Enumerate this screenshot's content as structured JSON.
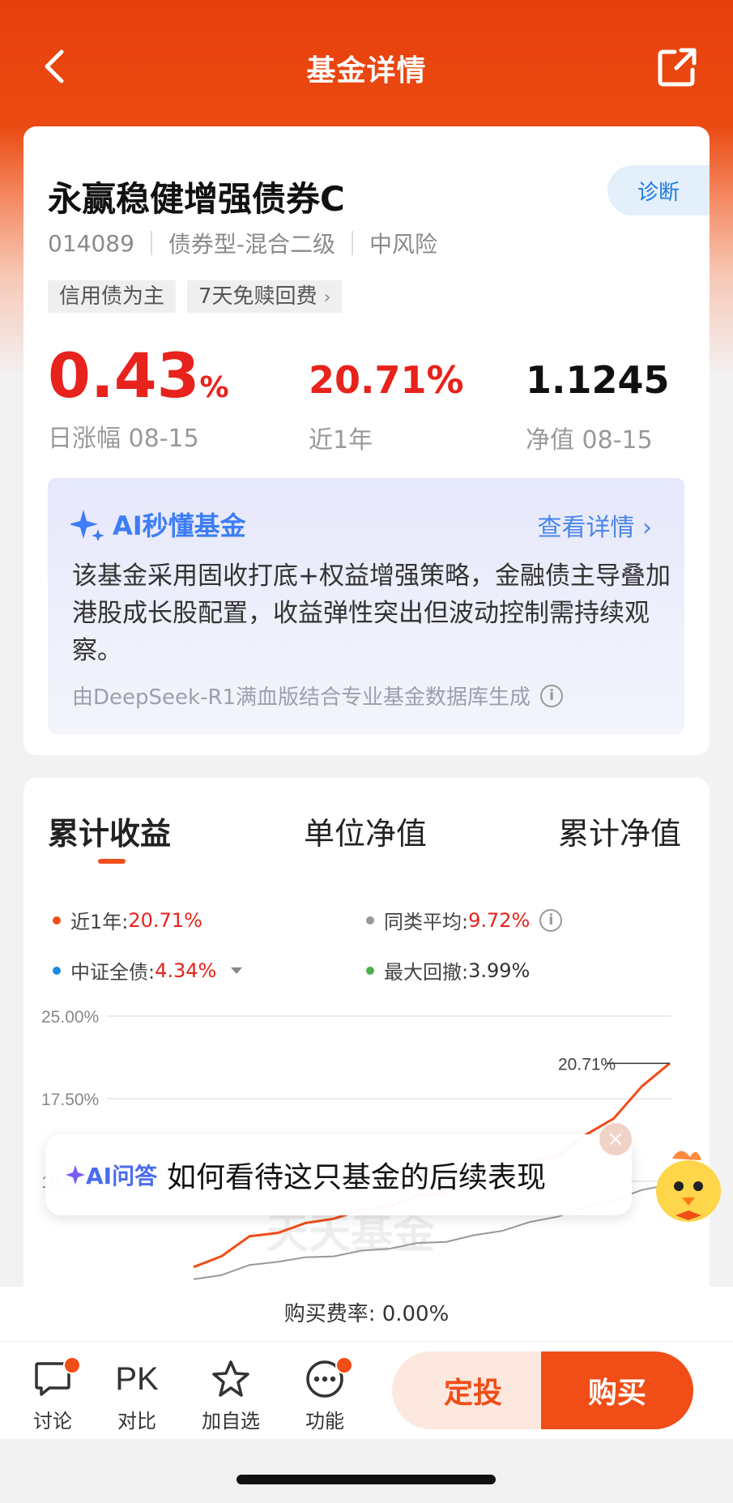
{
  "nav": {
    "title": "基金详情"
  },
  "fund": {
    "name": "永赢稳健增强债券C",
    "diagnose_label": "诊断",
    "code": "014089",
    "category": "债券型-混合二级",
    "risk": "中风险",
    "tags": [
      "信用债为主",
      "7天免赎回费"
    ],
    "day_change": "0.43",
    "day_change_unit": "%",
    "day_change_label": "日涨幅 08-15",
    "year_return": "20.71%",
    "year_return_label": "近1年",
    "nav_value": "1.1245",
    "nav_label": "净值 08-15"
  },
  "ai_summary": {
    "title": "AI秒懂基金",
    "more": "查看详情",
    "text": "该基金采用固收打底+权益增强策略，金融债主导叠加港股成长股配置，收益弹性突出但波动控制需持续观察。",
    "source": "由DeepSeek-R1满血版结合专业基金数据库生成"
  },
  "chart_tabs": [
    "累计收益",
    "单位净值",
    "累计净值"
  ],
  "legend": [
    {
      "label": "近1年:",
      "value": "20.71%",
      "color": "#f04d17"
    },
    {
      "label": "同类平均:",
      "value": "9.72%",
      "color": "#999999"
    },
    {
      "label": "中证全债:",
      "value": "4.34%",
      "color": "#1e88e5"
    },
    {
      "label": "最大回撤:",
      "value": "3.99%",
      "color": "#4caf50"
    }
  ],
  "chart_data": {
    "type": "line",
    "y_ticks": [
      "25.00%",
      "17.50%",
      "10.00%"
    ],
    "ylim": [
      0,
      25
    ],
    "end_label": "20.71%",
    "series": [
      {
        "name": "近1年",
        "color": "#f04d17",
        "values": [
          2.0,
          3.5,
          4.8,
          5.6,
          6.0,
          6.9,
          7.2,
          8.0,
          8.5,
          9.2,
          10.0,
          10.8,
          11.5,
          12.6,
          14.0,
          16.0,
          18.4,
          20.71
        ]
      },
      {
        "name": "同类平均",
        "color": "#999999",
        "values": [
          1.0,
          1.6,
          2.3,
          2.8,
          3.0,
          3.3,
          3.6,
          4.0,
          4.3,
          4.6,
          5.0,
          5.6,
          6.2,
          6.9,
          7.6,
          8.4,
          9.1,
          9.72
        ]
      }
    ]
  },
  "ai_ask": {
    "lead": "AI问答",
    "question": "如何看待这只基金的后续表现"
  },
  "watermark": "天天基金",
  "fee": "购买费率: 0.00%",
  "bottom": {
    "discuss": "讨论",
    "pk_icon": "PK",
    "compare": "对比",
    "watch": "加自选",
    "func": "功能",
    "ding": "定投",
    "buy": "购买"
  }
}
